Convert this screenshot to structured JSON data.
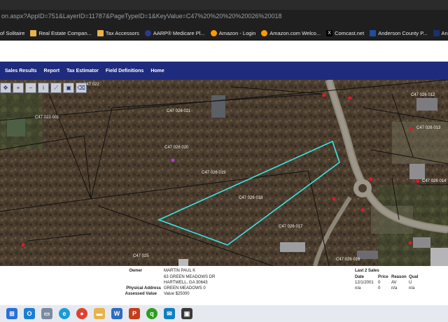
{
  "browser": {
    "url": "on.aspx?AppID=751&LayerID=11787&PageTypeID=1&KeyValue=C47%20%20%20%20026%20018"
  },
  "bookmarks": [
    {
      "label": "of Solitaire",
      "icon": "none"
    },
    {
      "label": "Real Estate Compan...",
      "icon": "folder-icon"
    },
    {
      "label": "Tax Accessors",
      "icon": "folder-icon"
    },
    {
      "label": "AARP® Medicare Pl...",
      "icon": "aarp-icon"
    },
    {
      "label": "Amazon - Login",
      "icon": "amazon-icon"
    },
    {
      "label": "Amazon.com Welco...",
      "icon": "amazon-icon"
    },
    {
      "label": "Comcast.net",
      "icon": "x-icon"
    },
    {
      "label": "Anderson County P...",
      "icon": "blue-icon"
    },
    {
      "label": "Anderson Cty SC Re...",
      "icon": "navy-icon"
    }
  ],
  "nav": {
    "items": [
      "Sales Results",
      "Report",
      "Tax Estimator",
      "Field Definitions",
      "Home"
    ]
  },
  "map": {
    "parcel_labels": [
      "C47  026 012",
      "C47  022",
      "C47  026 021",
      "C47  023 001",
      "C47  026 020",
      "C47  026 019",
      "C47  026 018",
      "C47  026 017",
      "C47  026 014",
      "C47  026 013",
      "C47  026 016",
      "C47  025"
    ],
    "highlight_color": "#39e6e6",
    "marker_color": "#e0182d"
  },
  "property": {
    "owner_label": "Owner",
    "owner_name": "MARTIN PAUL K",
    "owner_addr1": "63 GREEN MEADOWS DR",
    "owner_addr2": "HARTWELL, GA 30643",
    "physical_label": "Physical Address",
    "physical_value": "GREEN MEADOWS 0",
    "assessed_label": "Assessed Value",
    "assessed_value": "Value $25000"
  },
  "sales": {
    "title": "Last 2 Sales",
    "headers": [
      "Date",
      "Price",
      "Reason",
      "Qual"
    ],
    "rows": [
      [
        "12/1/2001",
        "0",
        "AV",
        "U"
      ],
      [
        "n/a",
        "0",
        "n/a",
        "n/a"
      ]
    ]
  }
}
